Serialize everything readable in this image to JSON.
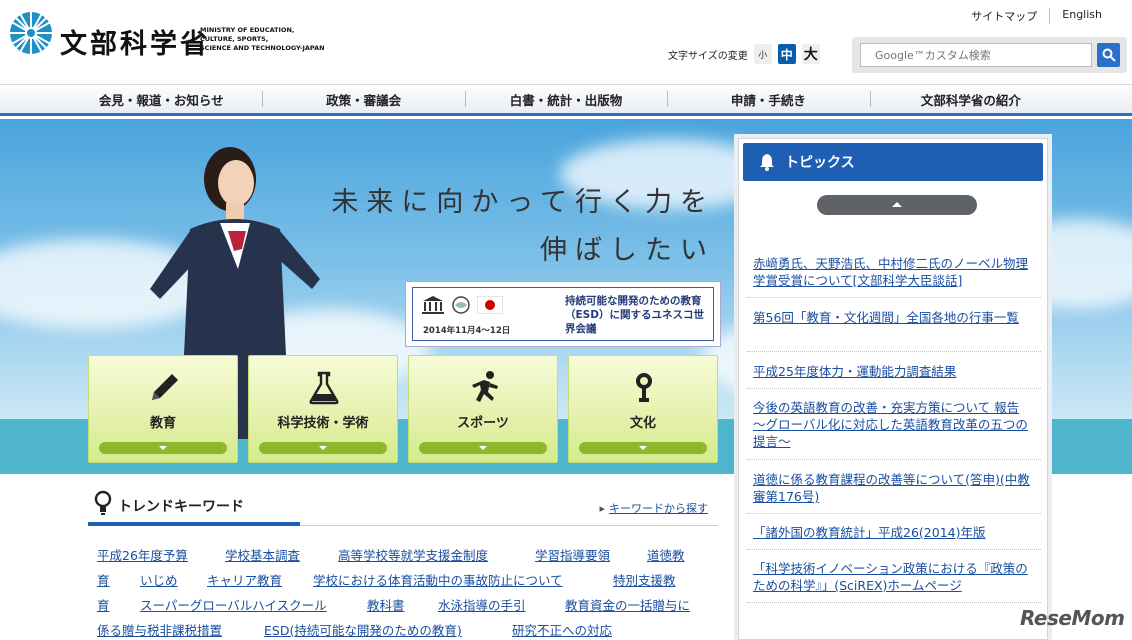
{
  "header": {
    "logo_ja": "文部科学省",
    "logo_en": [
      "MINISTRY OF EDUCATION,",
      "CULTURE, SPORTS,",
      "SCIENCE AND TECHNOLOGY-JAPAN"
    ],
    "util_links": [
      "サイトマップ",
      "English"
    ],
    "font_size_label": "文字サイズの変更",
    "font_sizes": [
      "小",
      "中",
      "大"
    ],
    "search_placeholder": "Google™カスタム検索"
  },
  "nav": {
    "items": [
      "会見・報道・お知らせ",
      "政策・審議会",
      "白書・統計・出版物",
      "申請・手続き",
      "文部科学省の紹介"
    ]
  },
  "hero": {
    "tagline_1": "未来に向かって行く力を",
    "tagline_2": "伸ばしたい",
    "esd_date": "2014年11月4〜12日",
    "esd_title": "持続可能な開発のための教育（ESD）に関するユネスコ世界会議"
  },
  "categories": [
    {
      "label": "教育",
      "icon": "pencil-icon"
    },
    {
      "label": "科学技術・学術",
      "icon": "flask-icon"
    },
    {
      "label": "スポーツ",
      "icon": "runner-icon"
    },
    {
      "label": "文化",
      "icon": "medal-icon"
    }
  ],
  "topics": {
    "title": "トピックス",
    "items": [
      "赤﨑勇氏、天野浩氏、中村修二氏のノーベル物理学賞受賞について[文部科学大臣談話]",
      "第56回「教育・文化週間」全国各地の行事一覧",
      "平成25年度体力・運動能力調査結果",
      "今後の英語教育の改善・充実方策について 報告 〜グローバル化に対応した英語教育改革の五つの提言〜",
      "道徳に係る教育課程の改善等について(答申)(中教審第176号)",
      "「諸外国の教育統計」平成26(2014)年版",
      "「科学技術イノベーション政策における『政策のための科学』」(SciREX)ホームページ"
    ]
  },
  "trend": {
    "title": "トレンドキーワード",
    "link": "キーワードから探す",
    "keywords": [
      "平成26年度予算",
      "学校基本調査",
      "高等学校等就学支援金制度",
      "学習指導要領",
      "道徳教",
      "育",
      "いじめ",
      "キャリア教育",
      "学校における体育活動中の事故防止について",
      "特別支援教",
      "育",
      "スーパーグローバルハイスクール",
      "教科書",
      "水泳指導の手引",
      "教育資金の一括贈与に",
      "係る贈与税非課税措置",
      "ESD(持続可能な開発のための教育)",
      "研究不正への対応"
    ]
  },
  "watermark": "ReseMom",
  "colors": {
    "brand_blue": "#1e5fb4",
    "category_green": "#8bb82c",
    "link": "#1a4fa0"
  }
}
